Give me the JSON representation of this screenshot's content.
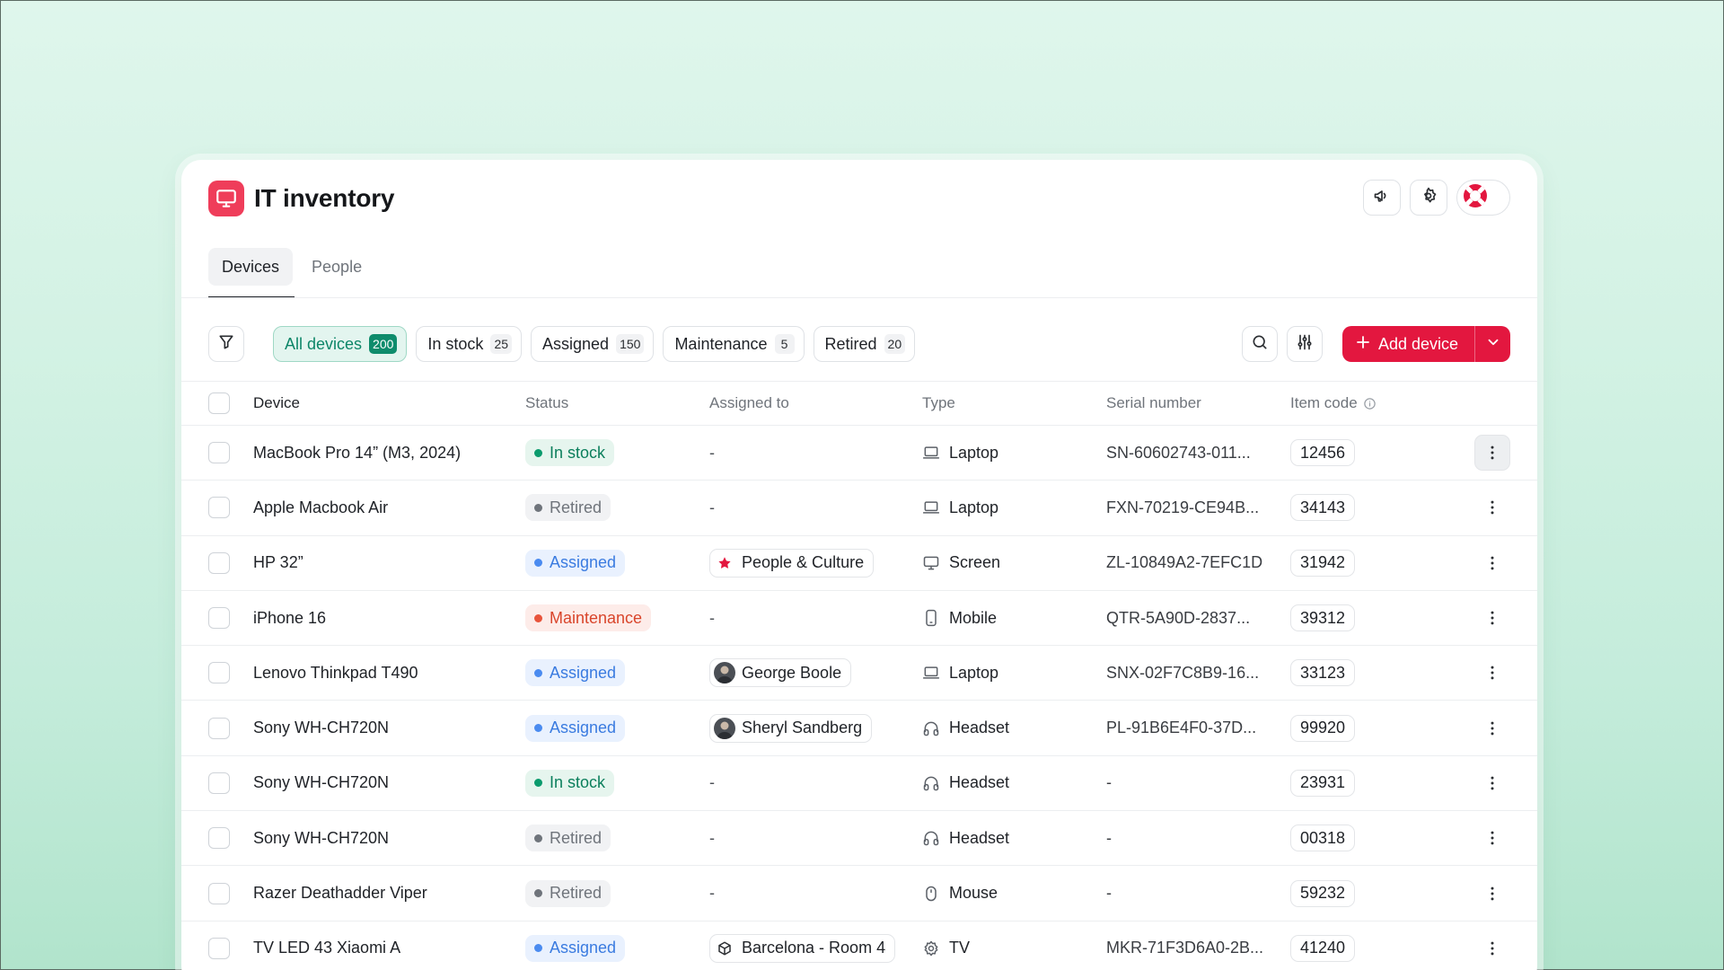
{
  "app": {
    "title": "IT inventory",
    "brand_color": "#ef3d5a"
  },
  "header_actions": [
    "megaphone-icon",
    "gear-icon",
    "help-lifebuoy-icon"
  ],
  "tabs": [
    {
      "label": "Devices",
      "active": true
    },
    {
      "label": "People",
      "active": false
    }
  ],
  "filters": {
    "pills": [
      {
        "label": "All devices",
        "count": "200",
        "active": true
      },
      {
        "label": "In stock",
        "count": "25",
        "active": false
      },
      {
        "label": "Assigned",
        "count": "150",
        "active": false
      },
      {
        "label": "Maintenance",
        "count": "5",
        "active": false
      },
      {
        "label": "Retired",
        "count": "20",
        "active": false
      }
    ],
    "add_button": "Add device",
    "accent": "#e3173f"
  },
  "table": {
    "headers": {
      "device": "Device",
      "status": "Status",
      "assigned_to": "Assigned to",
      "type": "Type",
      "serial_number": "Serial number",
      "item_code": "Item code"
    },
    "rows": [
      {
        "device": "MacBook Pro 14” (M3, 2024)",
        "status": "In stock",
        "status_kind": "instock",
        "assigned": "-",
        "assigned_kind": "none",
        "type": "Laptop",
        "type_icon": "laptop",
        "serial": "SN-60602743-011...",
        "code": "12456",
        "menu_hover": true
      },
      {
        "device": "Apple Macbook Air",
        "status": "Retired",
        "status_kind": "retired",
        "assigned": "-",
        "assigned_kind": "none",
        "type": "Laptop",
        "type_icon": "laptop",
        "serial": "FXN-70219-CE94B...",
        "code": "34143"
      },
      {
        "device": "HP 32”",
        "status": "Assigned",
        "status_kind": "assigned",
        "assigned": "People & Culture",
        "assigned_kind": "team",
        "type": "Screen",
        "type_icon": "screen",
        "serial": "ZL-10849A2-7EFC1D",
        "code": "31942"
      },
      {
        "device": "iPhone 16",
        "status": "Maintenance",
        "status_kind": "maintenance",
        "assigned": "-",
        "assigned_kind": "none",
        "type": "Mobile",
        "type_icon": "mobile",
        "serial": "QTR-5A90D-2837...",
        "code": "39312"
      },
      {
        "device": "Lenovo Thinkpad T490",
        "status": "Assigned",
        "status_kind": "assigned",
        "assigned": "George Boole",
        "assigned_kind": "person",
        "type": "Laptop",
        "type_icon": "laptop",
        "serial": "SNX-02F7C8B9-16...",
        "code": "33123"
      },
      {
        "device": "Sony WH-CH720N",
        "status": "Assigned",
        "status_kind": "assigned",
        "assigned": "Sheryl Sandberg",
        "assigned_kind": "person",
        "type": "Headset",
        "type_icon": "headset",
        "serial": "PL-91B6E4F0-37D...",
        "code": "99920"
      },
      {
        "device": "Sony WH-CH720N",
        "status": "In stock",
        "status_kind": "instock",
        "assigned": "-",
        "assigned_kind": "none",
        "type": "Headset",
        "type_icon": "headset",
        "serial": "-",
        "code": "23931"
      },
      {
        "device": "Sony WH-CH720N",
        "status": "Retired",
        "status_kind": "retired",
        "assigned": "-",
        "assigned_kind": "none",
        "type": "Headset",
        "type_icon": "headset",
        "serial": "-",
        "code": "00318"
      },
      {
        "device": "Razer Deathadder Viper",
        "status": "Retired",
        "status_kind": "retired",
        "assigned": "-",
        "assigned_kind": "none",
        "type": "Mouse",
        "type_icon": "mouse",
        "serial": "-",
        "code": "59232"
      },
      {
        "device": "TV LED 43 Xiaomi A",
        "status": "Assigned",
        "status_kind": "assigned",
        "assigned": "Barcelona - Room 4",
        "assigned_kind": "room",
        "type": "TV",
        "type_icon": "tv",
        "serial": "MKR-71F3D6A0-2B...",
        "code": "41240"
      }
    ]
  }
}
